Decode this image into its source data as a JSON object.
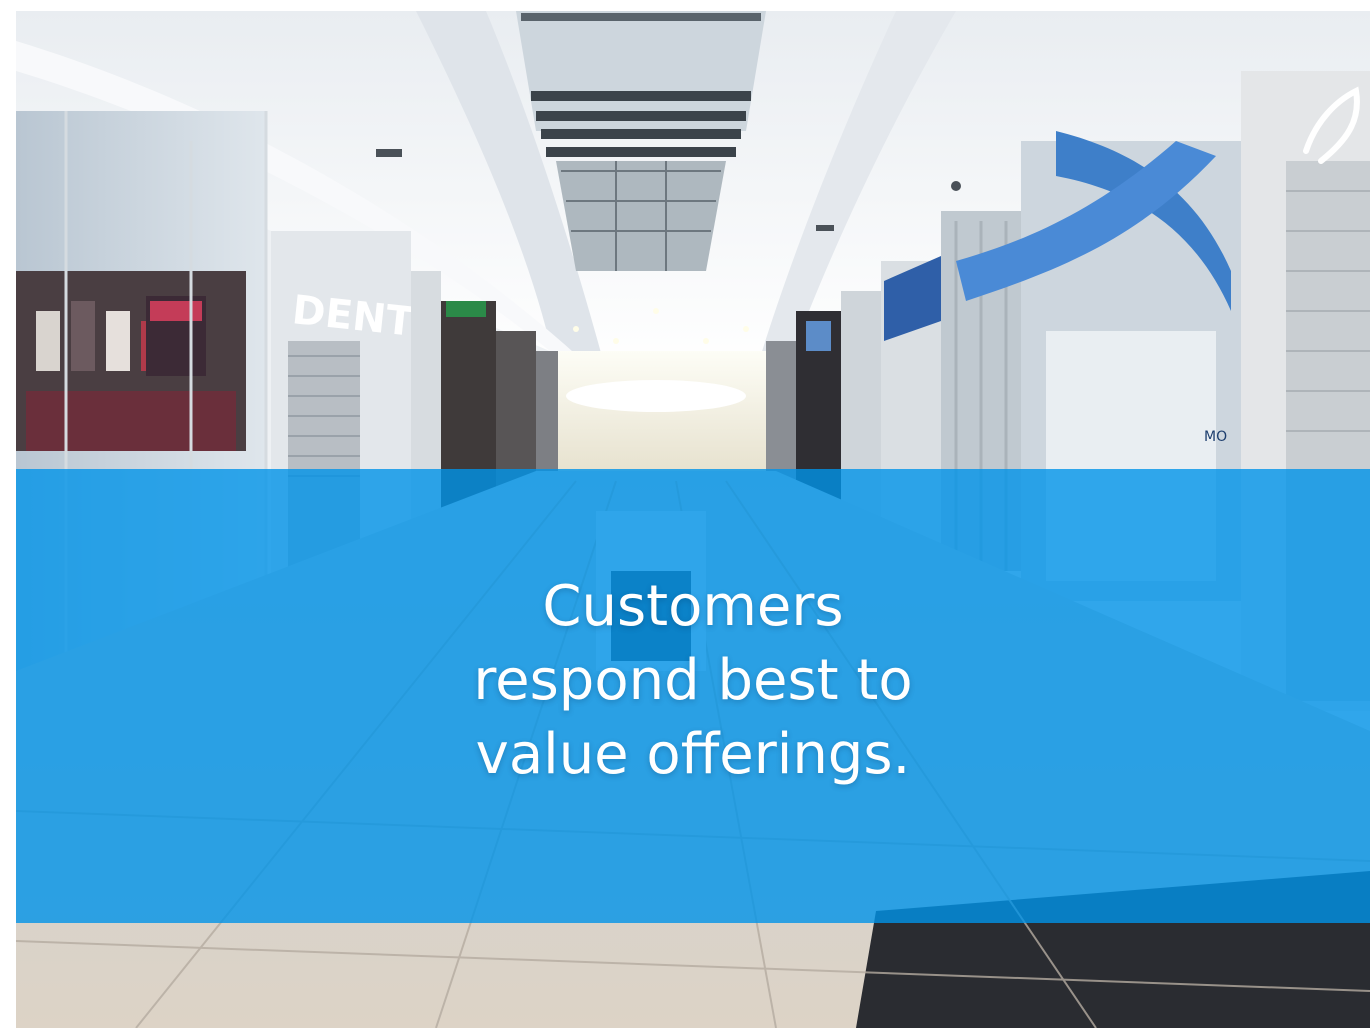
{
  "headline": {
    "lines": [
      "Customers",
      "respond best to",
      "value offerings."
    ]
  },
  "signage": {
    "store_sign": "DENTITY",
    "blue_sign": "",
    "window_text": "MO"
  },
  "colors": {
    "banner": "#0094E8",
    "headline_text": "#FFFFFF",
    "ceiling": "#F2F4F6",
    "floor": "#D9CFC4",
    "accent_blue": "#3E7FC9"
  }
}
